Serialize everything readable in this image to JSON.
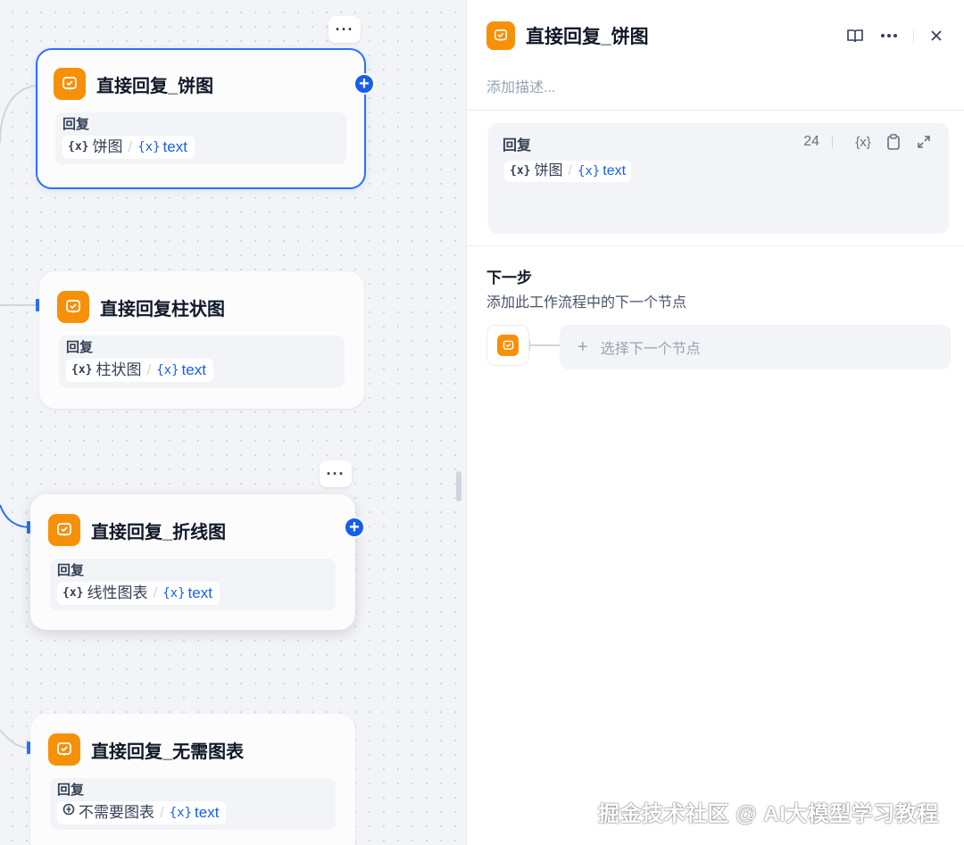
{
  "canvas": {
    "nodes": [
      {
        "title": "直接回复_饼图",
        "body_label": "回复",
        "var_name": "饼图",
        "var_text": "text"
      },
      {
        "title": "直接回复柱状图",
        "body_label": "回复",
        "var_name": "柱状图",
        "var_text": "text"
      },
      {
        "title": "直接回复_折线图",
        "body_label": "回复",
        "var_name": "线性图表",
        "var_text": "text"
      },
      {
        "title": "直接回复_无需图表",
        "body_label": "回复",
        "var_name": "不需要图表",
        "var_text": "text"
      }
    ],
    "more_label": "···",
    "plus_label": "+"
  },
  "panel": {
    "title": "直接回复_饼图",
    "description_placeholder": "添加描述...",
    "reply": {
      "label": "回复",
      "count": "24",
      "var_name": "饼图",
      "var_text": "text"
    },
    "next_step": {
      "title": "下一步",
      "subtitle": "添加此工作流程中的下一个节点",
      "select_label": "选择下一个节点"
    }
  },
  "var_icon": "{x}",
  "watermark": "掘金技术社区 @ AI大模型学习教程",
  "colors": {
    "accent": "#155eef",
    "node_icon": "#f79009",
    "selected_border": "#2970ff"
  }
}
